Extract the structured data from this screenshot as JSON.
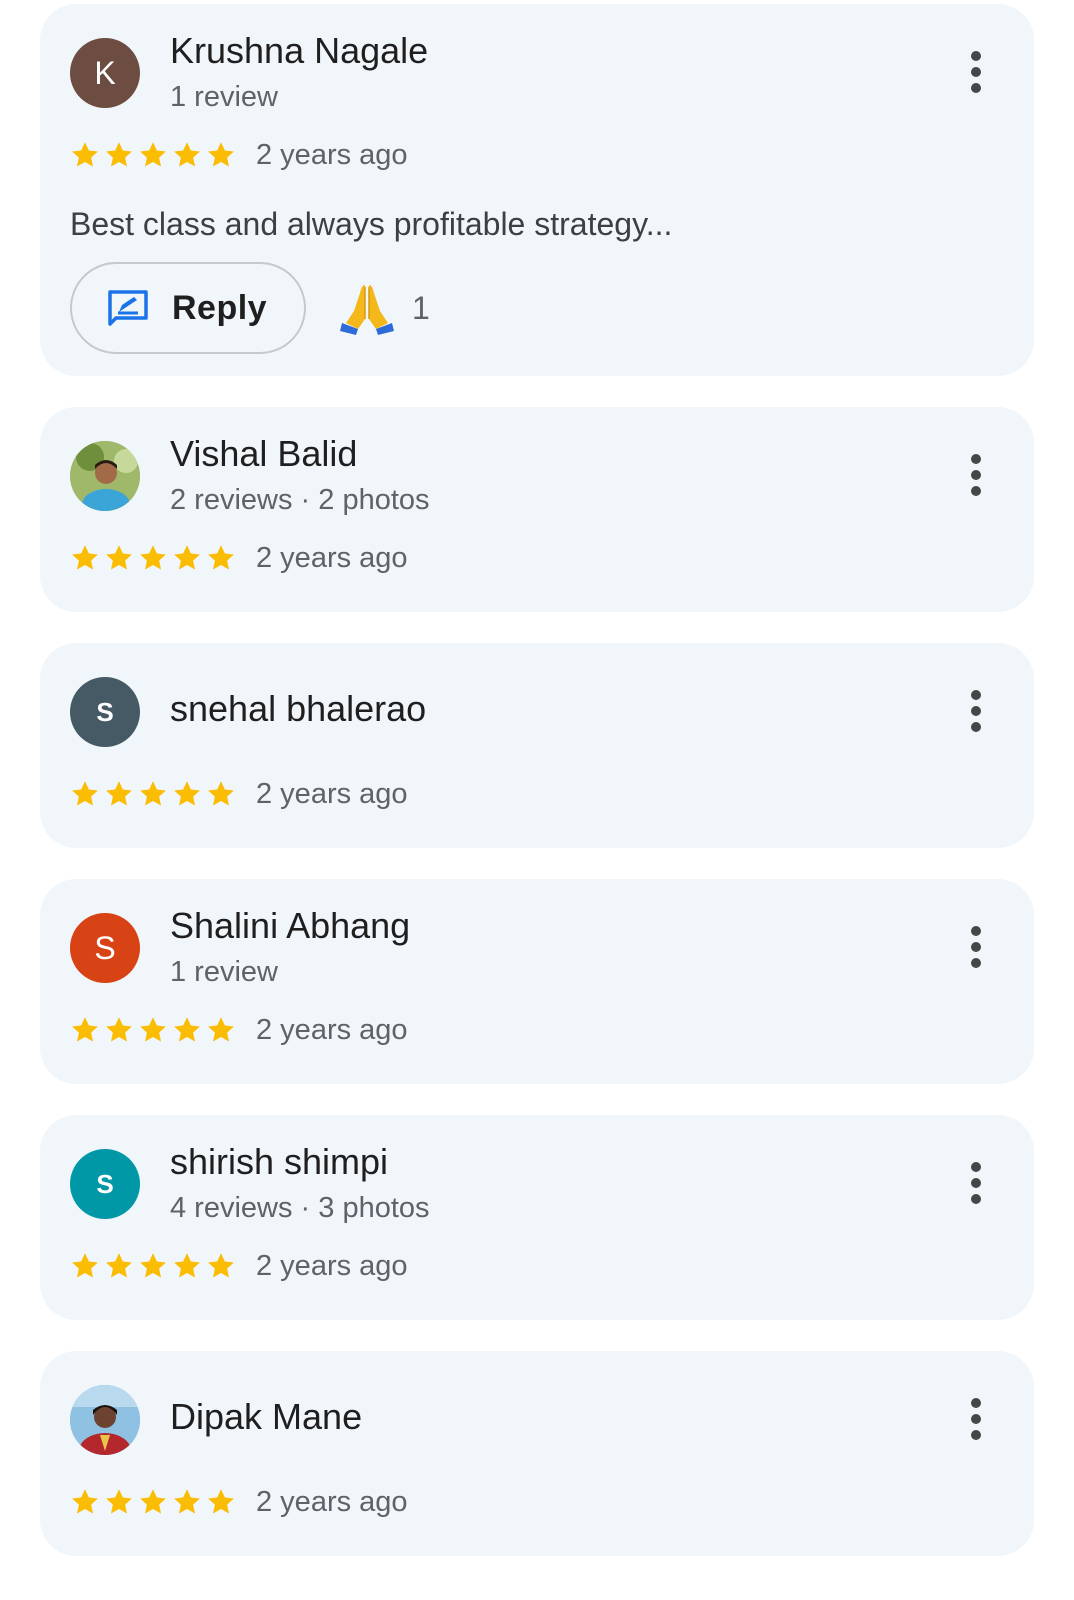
{
  "reviews": [
    {
      "name": "Krushna Nagale",
      "meta": "1 review",
      "avatar_letter": "K",
      "avatar_color": "#6d4c41",
      "rating": 5,
      "time": "2 years ago",
      "text": "Best class and always profitable strategy...",
      "reply_label": "Reply",
      "reaction_count": "1"
    },
    {
      "name": "Vishal Balid",
      "meta": "2 reviews · 2 photos",
      "avatar_type": "photo",
      "rating": 5,
      "time": "2 years ago"
    },
    {
      "name": "snehal bhalerao",
      "avatar_letter": "S",
      "avatar_color": "#455a64",
      "rating": 5,
      "time": "2 years ago"
    },
    {
      "name": "Shalini Abhang",
      "meta": "1 review",
      "avatar_letter": "S",
      "avatar_color": "#d84315",
      "rating": 5,
      "time": "2 years ago"
    },
    {
      "name": "shirish shimpi",
      "meta": "4 reviews · 3 photos",
      "avatar_letter": "S",
      "avatar_color": "#0097a7",
      "rating": 5,
      "time": "2 years ago"
    },
    {
      "name": "Dipak Mane",
      "avatar_type": "photo",
      "rating": 5,
      "time": "2 years ago"
    }
  ],
  "colors": {
    "card_bg": "#f1f6fb",
    "star": "#fbbc04",
    "reply_icon": "#1a73e8"
  }
}
